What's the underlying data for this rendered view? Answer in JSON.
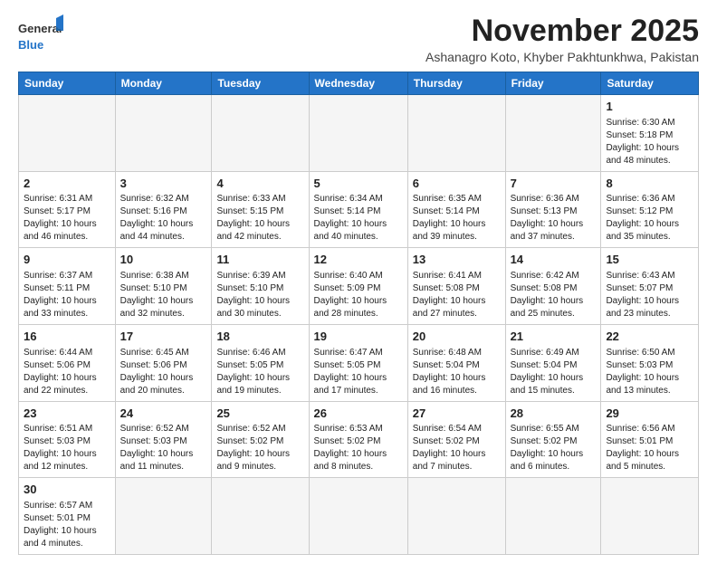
{
  "logo": {
    "text_general": "General",
    "text_blue": "Blue"
  },
  "header": {
    "month_year": "November 2025",
    "subtitle": "Ashanagro Koto, Khyber Pakhtunkhwa, Pakistan"
  },
  "weekdays": [
    "Sunday",
    "Monday",
    "Tuesday",
    "Wednesday",
    "Thursday",
    "Friday",
    "Saturday"
  ],
  "weeks": [
    [
      {
        "day": "",
        "info": ""
      },
      {
        "day": "",
        "info": ""
      },
      {
        "day": "",
        "info": ""
      },
      {
        "day": "",
        "info": ""
      },
      {
        "day": "",
        "info": ""
      },
      {
        "day": "",
        "info": ""
      },
      {
        "day": "1",
        "info": "Sunrise: 6:30 AM\nSunset: 5:18 PM\nDaylight: 10 hours and 48 minutes."
      }
    ],
    [
      {
        "day": "2",
        "info": "Sunrise: 6:31 AM\nSunset: 5:17 PM\nDaylight: 10 hours and 46 minutes."
      },
      {
        "day": "3",
        "info": "Sunrise: 6:32 AM\nSunset: 5:16 PM\nDaylight: 10 hours and 44 minutes."
      },
      {
        "day": "4",
        "info": "Sunrise: 6:33 AM\nSunset: 5:15 PM\nDaylight: 10 hours and 42 minutes."
      },
      {
        "day": "5",
        "info": "Sunrise: 6:34 AM\nSunset: 5:14 PM\nDaylight: 10 hours and 40 minutes."
      },
      {
        "day": "6",
        "info": "Sunrise: 6:35 AM\nSunset: 5:14 PM\nDaylight: 10 hours and 39 minutes."
      },
      {
        "day": "7",
        "info": "Sunrise: 6:36 AM\nSunset: 5:13 PM\nDaylight: 10 hours and 37 minutes."
      },
      {
        "day": "8",
        "info": "Sunrise: 6:36 AM\nSunset: 5:12 PM\nDaylight: 10 hours and 35 minutes."
      }
    ],
    [
      {
        "day": "9",
        "info": "Sunrise: 6:37 AM\nSunset: 5:11 PM\nDaylight: 10 hours and 33 minutes."
      },
      {
        "day": "10",
        "info": "Sunrise: 6:38 AM\nSunset: 5:10 PM\nDaylight: 10 hours and 32 minutes."
      },
      {
        "day": "11",
        "info": "Sunrise: 6:39 AM\nSunset: 5:10 PM\nDaylight: 10 hours and 30 minutes."
      },
      {
        "day": "12",
        "info": "Sunrise: 6:40 AM\nSunset: 5:09 PM\nDaylight: 10 hours and 28 minutes."
      },
      {
        "day": "13",
        "info": "Sunrise: 6:41 AM\nSunset: 5:08 PM\nDaylight: 10 hours and 27 minutes."
      },
      {
        "day": "14",
        "info": "Sunrise: 6:42 AM\nSunset: 5:08 PM\nDaylight: 10 hours and 25 minutes."
      },
      {
        "day": "15",
        "info": "Sunrise: 6:43 AM\nSunset: 5:07 PM\nDaylight: 10 hours and 23 minutes."
      }
    ],
    [
      {
        "day": "16",
        "info": "Sunrise: 6:44 AM\nSunset: 5:06 PM\nDaylight: 10 hours and 22 minutes."
      },
      {
        "day": "17",
        "info": "Sunrise: 6:45 AM\nSunset: 5:06 PM\nDaylight: 10 hours and 20 minutes."
      },
      {
        "day": "18",
        "info": "Sunrise: 6:46 AM\nSunset: 5:05 PM\nDaylight: 10 hours and 19 minutes."
      },
      {
        "day": "19",
        "info": "Sunrise: 6:47 AM\nSunset: 5:05 PM\nDaylight: 10 hours and 17 minutes."
      },
      {
        "day": "20",
        "info": "Sunrise: 6:48 AM\nSunset: 5:04 PM\nDaylight: 10 hours and 16 minutes."
      },
      {
        "day": "21",
        "info": "Sunrise: 6:49 AM\nSunset: 5:04 PM\nDaylight: 10 hours and 15 minutes."
      },
      {
        "day": "22",
        "info": "Sunrise: 6:50 AM\nSunset: 5:03 PM\nDaylight: 10 hours and 13 minutes."
      }
    ],
    [
      {
        "day": "23",
        "info": "Sunrise: 6:51 AM\nSunset: 5:03 PM\nDaylight: 10 hours and 12 minutes."
      },
      {
        "day": "24",
        "info": "Sunrise: 6:52 AM\nSunset: 5:03 PM\nDaylight: 10 hours and 11 minutes."
      },
      {
        "day": "25",
        "info": "Sunrise: 6:52 AM\nSunset: 5:02 PM\nDaylight: 10 hours and 9 minutes."
      },
      {
        "day": "26",
        "info": "Sunrise: 6:53 AM\nSunset: 5:02 PM\nDaylight: 10 hours and 8 minutes."
      },
      {
        "day": "27",
        "info": "Sunrise: 6:54 AM\nSunset: 5:02 PM\nDaylight: 10 hours and 7 minutes."
      },
      {
        "day": "28",
        "info": "Sunrise: 6:55 AM\nSunset: 5:02 PM\nDaylight: 10 hours and 6 minutes."
      },
      {
        "day": "29",
        "info": "Sunrise: 6:56 AM\nSunset: 5:01 PM\nDaylight: 10 hours and 5 minutes."
      }
    ],
    [
      {
        "day": "30",
        "info": "Sunrise: 6:57 AM\nSunset: 5:01 PM\nDaylight: 10 hours and 4 minutes."
      },
      {
        "day": "",
        "info": ""
      },
      {
        "day": "",
        "info": ""
      },
      {
        "day": "",
        "info": ""
      },
      {
        "day": "",
        "info": ""
      },
      {
        "day": "",
        "info": ""
      },
      {
        "day": "",
        "info": ""
      }
    ]
  ]
}
